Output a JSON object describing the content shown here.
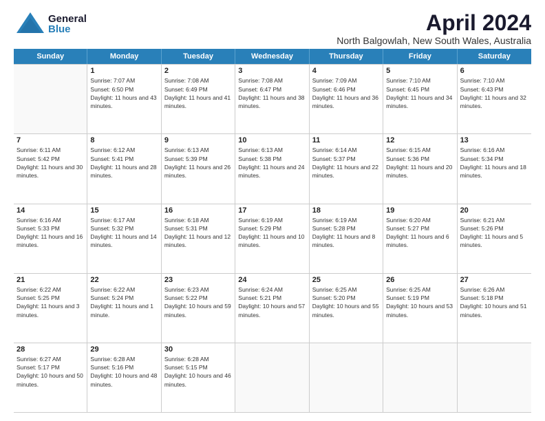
{
  "logo": {
    "general": "General",
    "blue": "Blue"
  },
  "header": {
    "title": "April 2024",
    "subtitle": "North Balgowlah, New South Wales, Australia"
  },
  "weekdays": [
    "Sunday",
    "Monday",
    "Tuesday",
    "Wednesday",
    "Thursday",
    "Friday",
    "Saturday"
  ],
  "weeks": [
    [
      {
        "date": "",
        "sunrise": "",
        "sunset": "",
        "daylight": ""
      },
      {
        "date": "1",
        "sunrise": "Sunrise: 7:07 AM",
        "sunset": "Sunset: 6:50 PM",
        "daylight": "Daylight: 11 hours and 43 minutes."
      },
      {
        "date": "2",
        "sunrise": "Sunrise: 7:08 AM",
        "sunset": "Sunset: 6:49 PM",
        "daylight": "Daylight: 11 hours and 41 minutes."
      },
      {
        "date": "3",
        "sunrise": "Sunrise: 7:08 AM",
        "sunset": "Sunset: 6:47 PM",
        "daylight": "Daylight: 11 hours and 38 minutes."
      },
      {
        "date": "4",
        "sunrise": "Sunrise: 7:09 AM",
        "sunset": "Sunset: 6:46 PM",
        "daylight": "Daylight: 11 hours and 36 minutes."
      },
      {
        "date": "5",
        "sunrise": "Sunrise: 7:10 AM",
        "sunset": "Sunset: 6:45 PM",
        "daylight": "Daylight: 11 hours and 34 minutes."
      },
      {
        "date": "6",
        "sunrise": "Sunrise: 7:10 AM",
        "sunset": "Sunset: 6:43 PM",
        "daylight": "Daylight: 11 hours and 32 minutes."
      }
    ],
    [
      {
        "date": "7",
        "sunrise": "Sunrise: 6:11 AM",
        "sunset": "Sunset: 5:42 PM",
        "daylight": "Daylight: 11 hours and 30 minutes."
      },
      {
        "date": "8",
        "sunrise": "Sunrise: 6:12 AM",
        "sunset": "Sunset: 5:41 PM",
        "daylight": "Daylight: 11 hours and 28 minutes."
      },
      {
        "date": "9",
        "sunrise": "Sunrise: 6:13 AM",
        "sunset": "Sunset: 5:39 PM",
        "daylight": "Daylight: 11 hours and 26 minutes."
      },
      {
        "date": "10",
        "sunrise": "Sunrise: 6:13 AM",
        "sunset": "Sunset: 5:38 PM",
        "daylight": "Daylight: 11 hours and 24 minutes."
      },
      {
        "date": "11",
        "sunrise": "Sunrise: 6:14 AM",
        "sunset": "Sunset: 5:37 PM",
        "daylight": "Daylight: 11 hours and 22 minutes."
      },
      {
        "date": "12",
        "sunrise": "Sunrise: 6:15 AM",
        "sunset": "Sunset: 5:36 PM",
        "daylight": "Daylight: 11 hours and 20 minutes."
      },
      {
        "date": "13",
        "sunrise": "Sunrise: 6:16 AM",
        "sunset": "Sunset: 5:34 PM",
        "daylight": "Daylight: 11 hours and 18 minutes."
      }
    ],
    [
      {
        "date": "14",
        "sunrise": "Sunrise: 6:16 AM",
        "sunset": "Sunset: 5:33 PM",
        "daylight": "Daylight: 11 hours and 16 minutes."
      },
      {
        "date": "15",
        "sunrise": "Sunrise: 6:17 AM",
        "sunset": "Sunset: 5:32 PM",
        "daylight": "Daylight: 11 hours and 14 minutes."
      },
      {
        "date": "16",
        "sunrise": "Sunrise: 6:18 AM",
        "sunset": "Sunset: 5:31 PM",
        "daylight": "Daylight: 11 hours and 12 minutes."
      },
      {
        "date": "17",
        "sunrise": "Sunrise: 6:19 AM",
        "sunset": "Sunset: 5:29 PM",
        "daylight": "Daylight: 11 hours and 10 minutes."
      },
      {
        "date": "18",
        "sunrise": "Sunrise: 6:19 AM",
        "sunset": "Sunset: 5:28 PM",
        "daylight": "Daylight: 11 hours and 8 minutes."
      },
      {
        "date": "19",
        "sunrise": "Sunrise: 6:20 AM",
        "sunset": "Sunset: 5:27 PM",
        "daylight": "Daylight: 11 hours and 6 minutes."
      },
      {
        "date": "20",
        "sunrise": "Sunrise: 6:21 AM",
        "sunset": "Sunset: 5:26 PM",
        "daylight": "Daylight: 11 hours and 5 minutes."
      }
    ],
    [
      {
        "date": "21",
        "sunrise": "Sunrise: 6:22 AM",
        "sunset": "Sunset: 5:25 PM",
        "daylight": "Daylight: 11 hours and 3 minutes."
      },
      {
        "date": "22",
        "sunrise": "Sunrise: 6:22 AM",
        "sunset": "Sunset: 5:24 PM",
        "daylight": "Daylight: 11 hours and 1 minute."
      },
      {
        "date": "23",
        "sunrise": "Sunrise: 6:23 AM",
        "sunset": "Sunset: 5:22 PM",
        "daylight": "Daylight: 10 hours and 59 minutes."
      },
      {
        "date": "24",
        "sunrise": "Sunrise: 6:24 AM",
        "sunset": "Sunset: 5:21 PM",
        "daylight": "Daylight: 10 hours and 57 minutes."
      },
      {
        "date": "25",
        "sunrise": "Sunrise: 6:25 AM",
        "sunset": "Sunset: 5:20 PM",
        "daylight": "Daylight: 10 hours and 55 minutes."
      },
      {
        "date": "26",
        "sunrise": "Sunrise: 6:25 AM",
        "sunset": "Sunset: 5:19 PM",
        "daylight": "Daylight: 10 hours and 53 minutes."
      },
      {
        "date": "27",
        "sunrise": "Sunrise: 6:26 AM",
        "sunset": "Sunset: 5:18 PM",
        "daylight": "Daylight: 10 hours and 51 minutes."
      }
    ],
    [
      {
        "date": "28",
        "sunrise": "Sunrise: 6:27 AM",
        "sunset": "Sunset: 5:17 PM",
        "daylight": "Daylight: 10 hours and 50 minutes."
      },
      {
        "date": "29",
        "sunrise": "Sunrise: 6:28 AM",
        "sunset": "Sunset: 5:16 PM",
        "daylight": "Daylight: 10 hours and 48 minutes."
      },
      {
        "date": "30",
        "sunrise": "Sunrise: 6:28 AM",
        "sunset": "Sunset: 5:15 PM",
        "daylight": "Daylight: 10 hours and 46 minutes."
      },
      {
        "date": "",
        "sunrise": "",
        "sunset": "",
        "daylight": ""
      },
      {
        "date": "",
        "sunrise": "",
        "sunset": "",
        "daylight": ""
      },
      {
        "date": "",
        "sunrise": "",
        "sunset": "",
        "daylight": ""
      },
      {
        "date": "",
        "sunrise": "",
        "sunset": "",
        "daylight": ""
      }
    ]
  ]
}
